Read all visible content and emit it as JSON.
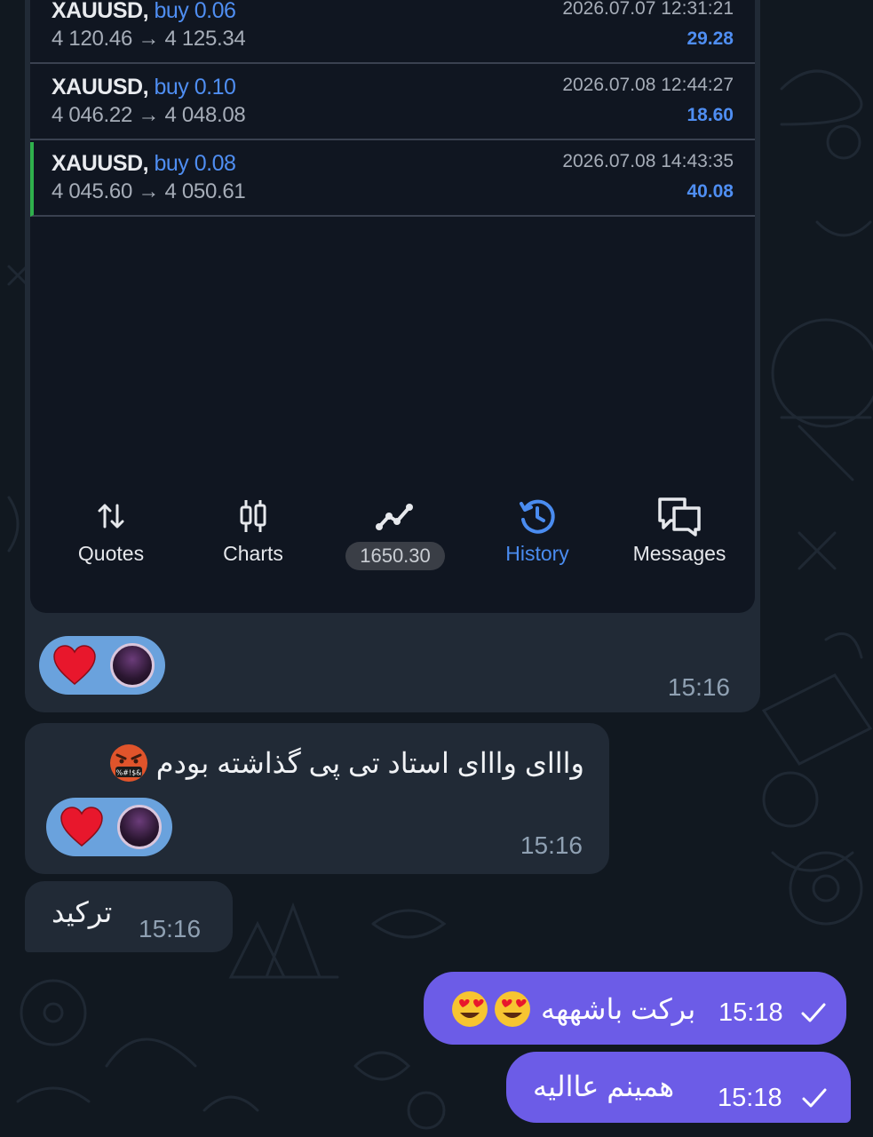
{
  "history_list": [
    {
      "symbol": "XAUUSD,",
      "side": "buy 0.06",
      "prices": "4 120.46 → 4 125.34",
      "datetime": "2026.07.07 12:31:21",
      "profit": "29.28"
    },
    {
      "symbol": "XAUUSD,",
      "side": "buy 0.10",
      "prices": "4 046.22 → 4 048.08",
      "datetime": "2026.07.08 12:44:27",
      "profit": "18.60"
    },
    {
      "symbol": "XAUUSD,",
      "side": "buy 0.08",
      "prices": "4 045.60 → 4 050.61",
      "datetime": "2026.07.08 14:43:35",
      "profit": "40.08"
    }
  ],
  "bottom_nav": {
    "quotes": "Quotes",
    "charts": "Charts",
    "balance": "1650.30",
    "history": "History",
    "messages": "Messages"
  },
  "messages": {
    "m1_time": "15:16",
    "m2_text": "واااى واااى استاد تى پى گذاشته بودم",
    "m2_time": "15:16",
    "m3_text": "تركيد",
    "m3_time": "15:16",
    "m4_text": "بركت باشههه",
    "m4_time": "15:18",
    "m5_text": "همينم عااليه",
    "m5_time": "15:18"
  },
  "colors": {
    "chat_bg": "#111820",
    "incoming_bubble": "#212a36",
    "outgoing_bubble": "#6c5ce7",
    "reaction_bg": "#6aa2dd",
    "accent_blue": "#4f8ef2",
    "active_bar": "#2fb04c"
  },
  "icons": [
    "quotes-icon",
    "charts-icon",
    "trade-icon",
    "history-icon",
    "messages-icon",
    "heart-icon",
    "check-icon",
    "heart-eyes-emoji",
    "cursing-face-emoji"
  ]
}
